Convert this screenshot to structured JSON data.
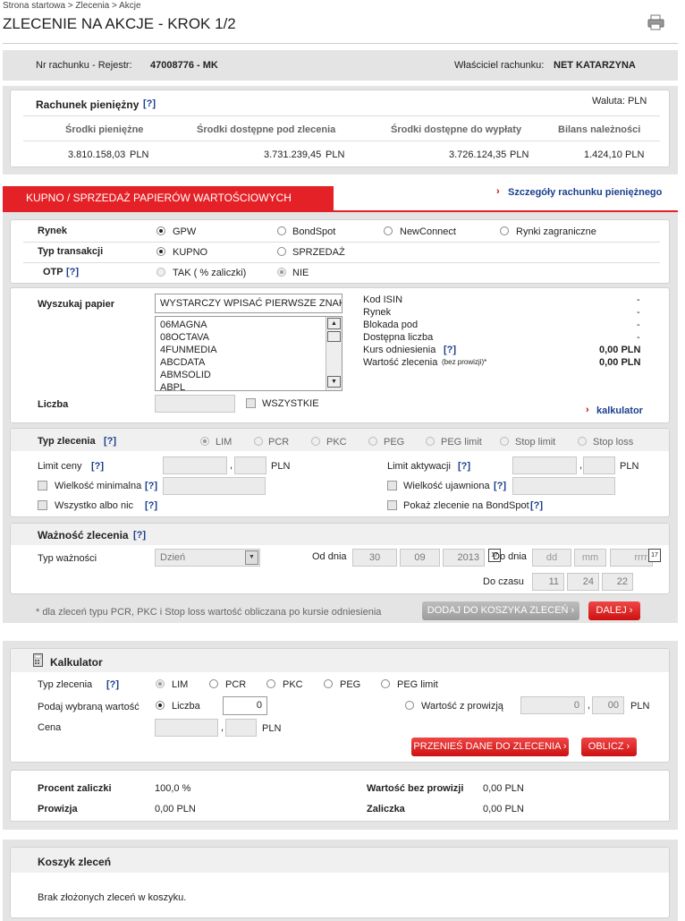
{
  "breadcrumb": "Strona startowa > Zlecenia > Akcje",
  "page_title": "ZLECENIE NA AKCJE - KROK 1/2",
  "account": {
    "nr_label": "Nr rachunku - Rejestr:",
    "nr_value": "47008776 - MK",
    "owner_label": "Właściciel rachunku:",
    "owner_value": "NET KATARZYNA"
  },
  "cash": {
    "title": "Rachunek pieniężny",
    "help": "[?]",
    "currency": "Waluta: PLN",
    "cols": [
      "Środki pieniężne",
      "Środki dostępne pod zlecenia",
      "Środki dostępne do wypłaty",
      "Bilans należności"
    ],
    "vals": [
      "3.810.158,03",
      "3.731.239,45",
      "3.726.124,35",
      "1.424,10"
    ],
    "unit": "PLN"
  },
  "tab": {
    "label": "KUPNO / SPRZEDAŻ PAPIERÓW WARTOŚCIOWYCH",
    "details_link": "Szczegóły rachunku pieniężnego",
    "arrow": "›"
  },
  "market": {
    "label": "Rynek",
    "options": [
      "GPW",
      "BondSpot",
      "NewConnect",
      "Rynki zagraniczne"
    ]
  },
  "txn": {
    "label": "Typ transakcji",
    "options": [
      "KUPNO",
      "SPRZEDAŻ"
    ]
  },
  "otp": {
    "label": "OTP",
    "help": "[?]",
    "options": [
      "TAK (  % zaliczki)",
      "NIE"
    ]
  },
  "search": {
    "label": "Wyszukaj papier",
    "value": "WYSTARCZY WPISAĆ PIERWSZE ZNAKI",
    "list": [
      "06MAGNA",
      "08OCTAVA",
      "4FUNMEDIA",
      "ABCDATA",
      "ABMSOLID",
      "ABPL"
    ],
    "count_label": "Liczba",
    "all_label": "WSZYSTKIE",
    "calc_link": "kalkulator"
  },
  "info": {
    "rows": [
      "Kod ISIN",
      "Rynek",
      "Blokada pod",
      "Dostępna liczba"
    ],
    "dash": "-",
    "ref_label": "Kurs odniesienia",
    "ref_help": "[?]",
    "ref_value": "0,00 PLN",
    "val_label": "Wartość zlecenia",
    "val_small": "(bez prowizji)*",
    "val_value": "0,00 PLN"
  },
  "order": {
    "label": "Typ zlecenia",
    "help": "[?]",
    "types": [
      "LIM",
      "PCR",
      "PKC",
      "PEG",
      "PEG limit",
      "Stop limit",
      "Stop loss"
    ],
    "limit_label": "Limit ceny",
    "act_label": "Limit aktywacji",
    "pln": "PLN",
    "comma": ",",
    "min_label": "Wielkość minimalna",
    "vis_label": "Wielkość ujawniona",
    "aon_label": "Wszystko albo nic",
    "bond_label": "Pokaż zlecenie na BondSpot"
  },
  "validity": {
    "title": "Ważność zlecenia",
    "help": "[?]",
    "type_label": "Typ ważności",
    "type_value": "Dzień",
    "from_label": "Od dnia",
    "from": [
      "30",
      "09",
      "2013"
    ],
    "to_label": "Do dnia",
    "to": [
      "dd",
      "mm",
      "rrrr"
    ],
    "time_label": "Do czasu",
    "time": [
      "11",
      "24",
      "22"
    ],
    "cal": "17",
    "note": "* dla zleceń typu PCR, PKC i Stop loss wartość obliczana po kursie odniesienia",
    "add_btn": "DODAJ DO KOSZYKA ZLECEŃ ›",
    "next_btn": "DALEJ ›"
  },
  "calc": {
    "title": "Kalkulator",
    "type_label": "Typ zlecenia",
    "help": "[?]",
    "types": [
      "LIM",
      "PCR",
      "PKC",
      "PEG",
      "PEG limit"
    ],
    "input_label": "Podaj wybraną wartość",
    "count_label": "Liczba",
    "count_value": "0",
    "withfee_label": "Wartość z prowizją",
    "withfee_int": "0",
    "withfee_dec": "00",
    "price_label": "Cena",
    "pln": "PLN",
    "comma": ",",
    "transfer_btn": "PRZENIEŚ DANE DO ZLECENIA ›",
    "calc_btn": "OBLICZ ›",
    "pct_label": "Procent zaliczki",
    "pct_value": "100,0  %",
    "fee_label": "Prowizja",
    "fee_value": "0,00  PLN",
    "nofee_label": "Wartość bez prowizji",
    "nofee_value": "0,00  PLN",
    "adv_label": "Zaliczka",
    "adv_value": "0,00  PLN"
  },
  "basket": {
    "title": "Koszyk zleceń",
    "empty": "Brak złożonych zleceń w koszyku."
  }
}
